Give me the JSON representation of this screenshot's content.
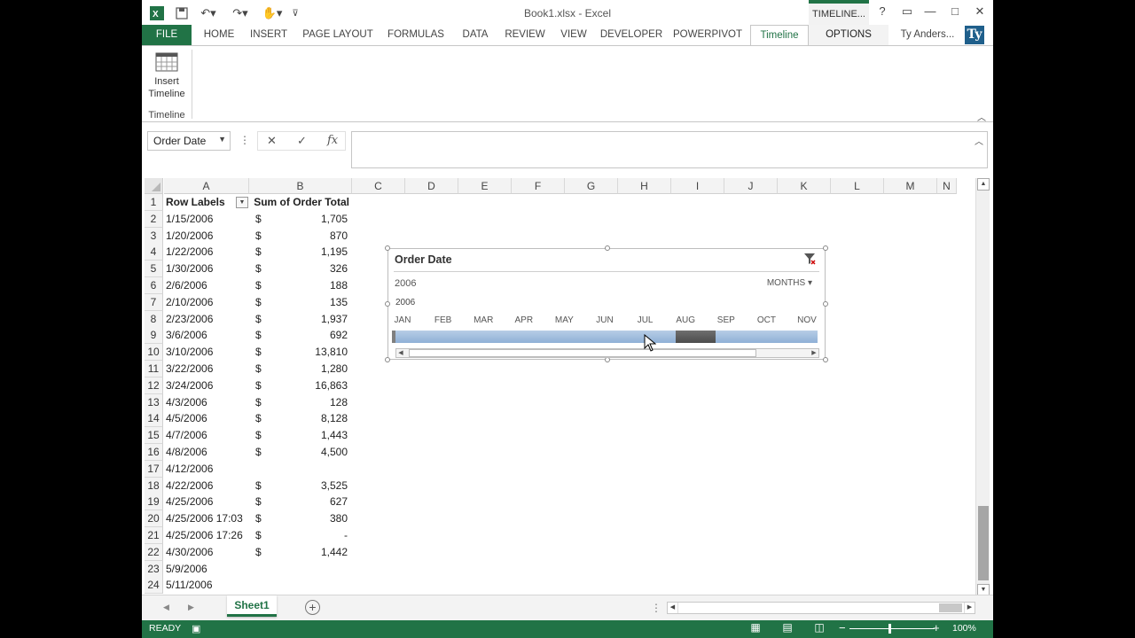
{
  "titlebar": {
    "title": "Book1.xlsx - Excel",
    "context_tab": "TIMELINE...",
    "help": "?",
    "minimize": "—",
    "restore": "□",
    "close": "✕"
  },
  "tabs": {
    "file": "FILE",
    "home": "HOME",
    "insert": "INSERT",
    "page_layout": "PAGE LAYOUT",
    "formulas": "FORMULAS",
    "data": "DATA",
    "review": "REVIEW",
    "view": "VIEW",
    "developer": "DEVELOPER",
    "powerpivot": "POWERPIVOT",
    "timeline": "Timeline",
    "options": "OPTIONS",
    "user": "Ty Anders...",
    "avatar": "Ty"
  },
  "ribbon": {
    "insert_timeline_line1": "Insert",
    "insert_timeline_line2": "Timeline",
    "group_label": "Timeline"
  },
  "formula_bar": {
    "name_box": "Order Date",
    "cancel": "✕",
    "enter": "✓",
    "fx": "fx",
    "value": ""
  },
  "columns": [
    "A",
    "B",
    "C",
    "D",
    "E",
    "F",
    "G",
    "H",
    "I",
    "J",
    "K",
    "L",
    "M",
    "N"
  ],
  "pivot": {
    "header_a": "Row Labels",
    "header_b": "Sum of Order Total",
    "rows": [
      {
        "n": "2",
        "date": "1/15/2006",
        "dollar": "$",
        "amount": "1,705"
      },
      {
        "n": "3",
        "date": "1/20/2006",
        "dollar": "$",
        "amount": "870"
      },
      {
        "n": "4",
        "date": "1/22/2006",
        "dollar": "$",
        "amount": "1,195"
      },
      {
        "n": "5",
        "date": "1/30/2006",
        "dollar": "$",
        "amount": "326"
      },
      {
        "n": "6",
        "date": "2/6/2006",
        "dollar": "$",
        "amount": "188"
      },
      {
        "n": "7",
        "date": "2/10/2006",
        "dollar": "$",
        "amount": "135"
      },
      {
        "n": "8",
        "date": "2/23/2006",
        "dollar": "$",
        "amount": "1,937"
      },
      {
        "n": "9",
        "date": "3/6/2006",
        "dollar": "$",
        "amount": "692"
      },
      {
        "n": "10",
        "date": "3/10/2006",
        "dollar": "$",
        "amount": "13,810"
      },
      {
        "n": "11",
        "date": "3/22/2006",
        "dollar": "$",
        "amount": "1,280"
      },
      {
        "n": "12",
        "date": "3/24/2006",
        "dollar": "$",
        "amount": "16,863"
      },
      {
        "n": "13",
        "date": "4/3/2006",
        "dollar": "$",
        "amount": "128"
      },
      {
        "n": "14",
        "date": "4/5/2006",
        "dollar": "$",
        "amount": "8,128"
      },
      {
        "n": "15",
        "date": "4/7/2006",
        "dollar": "$",
        "amount": "1,443"
      },
      {
        "n": "16",
        "date": "4/8/2006",
        "dollar": "$",
        "amount": "4,500"
      },
      {
        "n": "17",
        "date": "4/12/2006",
        "dollar": "",
        "amount": ""
      },
      {
        "n": "18",
        "date": "4/22/2006",
        "dollar": "$",
        "amount": "3,525"
      },
      {
        "n": "19",
        "date": "4/25/2006",
        "dollar": "$",
        "amount": "627"
      },
      {
        "n": "20",
        "date": "4/25/2006 17:03",
        "dollar": "$",
        "amount": "380"
      },
      {
        "n": "21",
        "date": "4/25/2006 17:26",
        "dollar": "$",
        "amount": "-"
      },
      {
        "n": "22",
        "date": "4/30/2006",
        "dollar": "$",
        "amount": "1,442"
      },
      {
        "n": "23",
        "date": "5/9/2006",
        "dollar": "",
        "amount": ""
      },
      {
        "n": "24",
        "date": "5/11/2006",
        "dollar": "",
        "amount": ""
      }
    ]
  },
  "timeline": {
    "title": "Order Date",
    "period": "2006",
    "level": "MONTHS",
    "year": "2006",
    "months": [
      "JAN",
      "FEB",
      "MAR",
      "APR",
      "MAY",
      "JUN",
      "JUL",
      "AUG",
      "SEP",
      "OCT",
      "NOV"
    ],
    "selected_month": "AUG"
  },
  "sheets": {
    "active": "Sheet1"
  },
  "status": {
    "ready": "READY",
    "zoom": "100%",
    "zoom_minus": "−",
    "zoom_plus": "+"
  },
  "colors": {
    "excel_green": "#217346",
    "timeline_bar": "#9bbbe0",
    "timeline_selected": "#555555"
  }
}
